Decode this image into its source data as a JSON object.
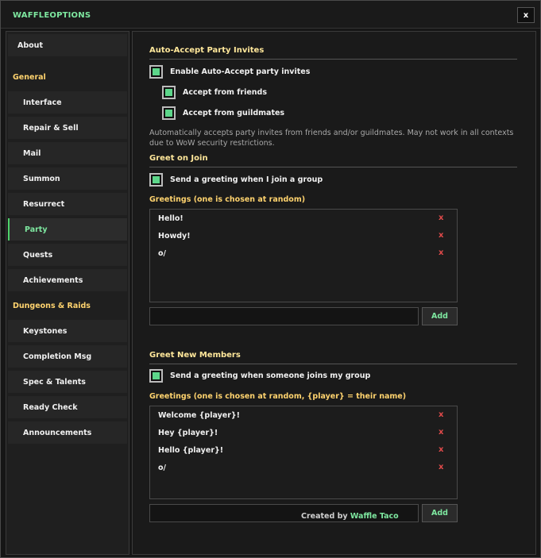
{
  "window": {
    "title": "WAFFLEOPTIONS",
    "close_label": "x"
  },
  "sidebar": {
    "about": "About",
    "general_header": "General",
    "general_items": [
      "Interface",
      "Repair & Sell",
      "Mail",
      "Summon",
      "Resurrect",
      "Party",
      "Quests",
      "Achievements"
    ],
    "dungeons_header": "Dungeons & Raids",
    "dungeons_items": [
      "Keystones",
      "Completion Msg",
      "Spec & Talents",
      "Ready Check",
      "Announcements"
    ],
    "active_item": "Party"
  },
  "auto_accept": {
    "title": "Auto-Accept Party Invites",
    "enable_label": "Enable Auto-Accept party invites",
    "enable_checked": true,
    "friends_label": "Accept from friends",
    "friends_checked": true,
    "guild_label": "Accept from guildmates",
    "guild_checked": true,
    "description": "Automatically accepts party invites from friends and/or guildmates. May not work in all contexts due to WoW security restrictions."
  },
  "greet_on_join": {
    "title": "Greet on Join",
    "checkbox_label": "Send a greeting when I join a group",
    "checked": true,
    "list_label": "Greetings (one is chosen at random)",
    "greetings": [
      "Hello!",
      "Howdy!",
      "o/"
    ],
    "remove_label": "x",
    "input_value": "",
    "add_label": "Add"
  },
  "greet_new_members": {
    "title": "Greet New Members",
    "checkbox_label": "Send a greeting when someone joins my group",
    "checked": true,
    "list_label": "Greetings (one is chosen at random, {player} = their name)",
    "greetings": [
      "Welcome {player}!",
      "Hey {player}!",
      "Hello {player}!",
      "o/"
    ],
    "remove_label": "x",
    "input_value": "",
    "add_label": "Add"
  },
  "footer": {
    "created_by": "Created by",
    "author": "Waffle Taco"
  },
  "colors": {
    "accent_green": "#7ee8a0",
    "header_gold": "#ffd36e",
    "remove_red": "#e04a4a",
    "checkbox_fill": "#5dd68a"
  }
}
